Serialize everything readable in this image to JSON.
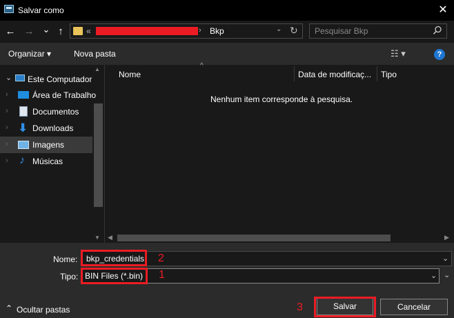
{
  "window": {
    "title": "Salvar como",
    "close_glyph": "✕"
  },
  "nav": {
    "back_glyph": "←",
    "forward_glyph": "→",
    "recent_glyph": "⌄",
    "up_glyph": "↑"
  },
  "address": {
    "overflow_glyph": "«",
    "separator_glyph": "›",
    "current_folder": "Bkp",
    "dropdown_glyph": "⌄",
    "refresh_glyph": "↻",
    "redaction_color": "#ec1c24"
  },
  "search": {
    "placeholder": "Pesquisar Bkp",
    "icon": "search-icon"
  },
  "toolbar": {
    "organize_label": "Organizar ▾",
    "new_folder_label": "Nova pasta",
    "view_glyph": "☷ ▾",
    "help_glyph": "?"
  },
  "sidebar": {
    "items": [
      {
        "label": "Este Computador",
        "icon": "computer-icon",
        "expanded": true,
        "selected": false
      },
      {
        "label": "Área de Trabalho",
        "icon": "desktop-icon",
        "selected": false
      },
      {
        "label": "Documentos",
        "icon": "documents-icon",
        "selected": false
      },
      {
        "label": "Downloads",
        "icon": "downloads-icon",
        "selected": false
      },
      {
        "label": "Imagens",
        "icon": "pictures-icon",
        "selected": true
      },
      {
        "label": "Músicas",
        "icon": "music-icon",
        "selected": false
      }
    ]
  },
  "filelist": {
    "columns": [
      "Nome",
      "Data de modificaç...",
      "Tipo"
    ],
    "sort_glyph": "^",
    "empty_message": "Nenhum item corresponde à pesquisa."
  },
  "form": {
    "name_label": "Nome:",
    "name_value": "bkp_credentials",
    "type_label": "Tipo:",
    "type_value": "BIN Files (*.bin)"
  },
  "annotations": {
    "name_step": "2",
    "type_step": "1",
    "save_step": "3",
    "color": "#ec1c24"
  },
  "footer": {
    "hide_folders_label": "Ocultar pastas",
    "hide_chevron": "⌃",
    "save_label": "Salvar",
    "cancel_label": "Cancelar"
  },
  "colors": {
    "background": "#191919",
    "panel": "#2b2b2b",
    "accent_help": "#1e76d2",
    "folder": "#e8c35a"
  }
}
